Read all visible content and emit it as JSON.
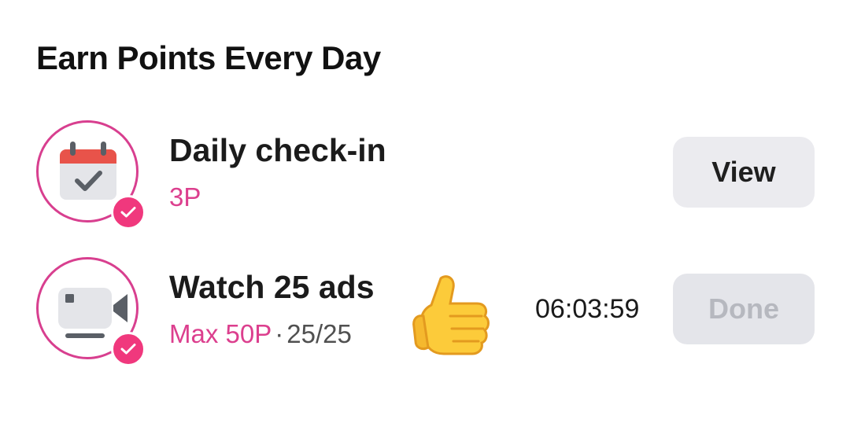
{
  "section": {
    "title": "Earn Points Every Day"
  },
  "tasks": [
    {
      "title": "Daily check-in",
      "reward": "3P",
      "icon": "calendar-check-icon",
      "completed": true,
      "button_label": "View"
    },
    {
      "title": "Watch 25 ads",
      "reward": "Max 50P",
      "separator": "·",
      "progress": "25/25",
      "icon": "video-camera-icon",
      "completed": true,
      "timer": "06:03:59",
      "decoration": "thumbs-up-icon",
      "button_label": "Done"
    }
  ],
  "colors": {
    "accent": "#dc3f8e",
    "badge": "#f0387d",
    "calendar_top": "#e8534a",
    "button_bg": "#ebebef",
    "disabled_text": "#b6b8bf"
  }
}
